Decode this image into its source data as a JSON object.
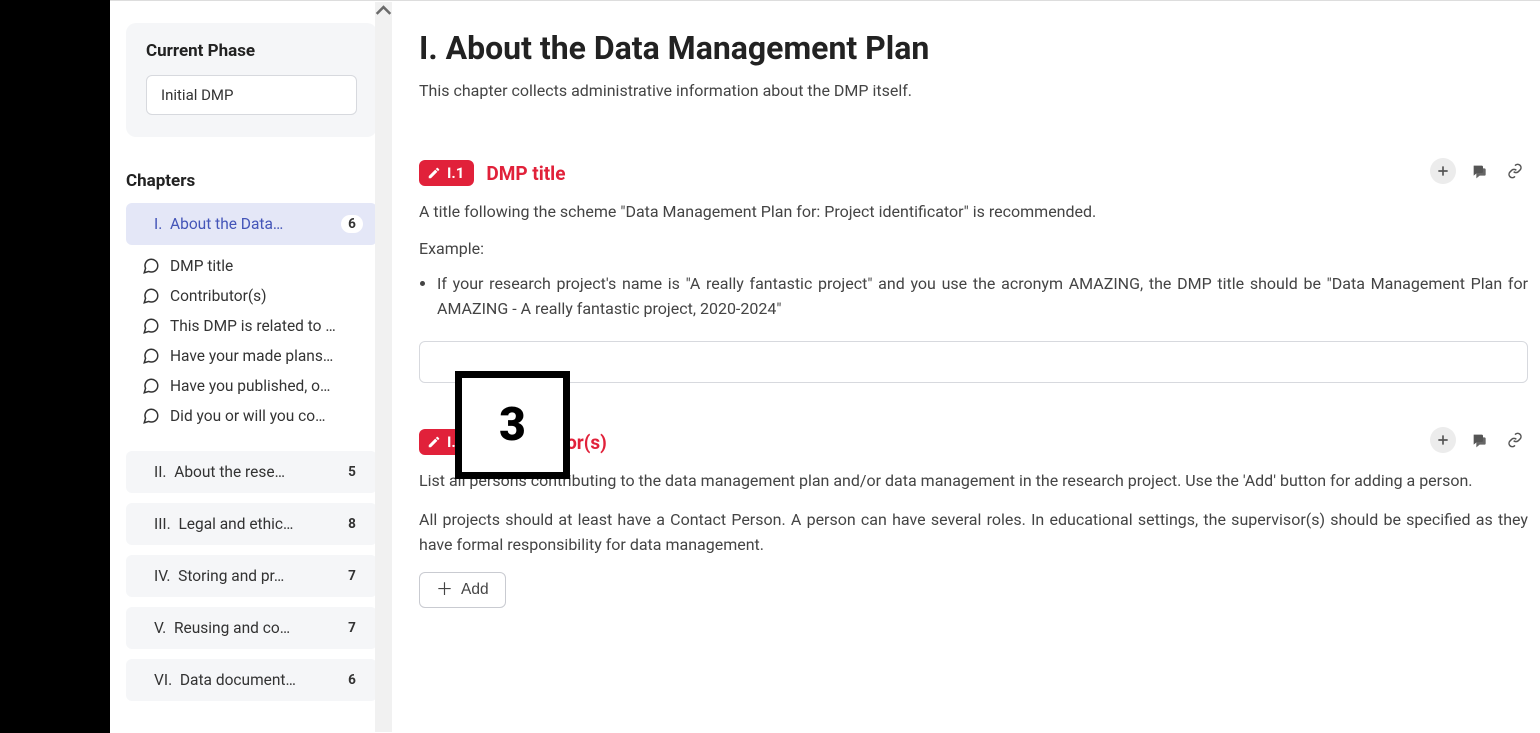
{
  "sidebar": {
    "phase_label": "Current Phase",
    "phase_value": "Initial DMP",
    "chapters_label": "Chapters",
    "chapters": [
      {
        "num": "I.",
        "label": "About the Data…",
        "count": "6",
        "active": true
      },
      {
        "num": "II.",
        "label": "About the rese…",
        "count": "5",
        "active": false
      },
      {
        "num": "III.",
        "label": "Legal and ethic…",
        "count": "8",
        "active": false
      },
      {
        "num": "IV.",
        "label": "Storing and pr…",
        "count": "7",
        "active": false
      },
      {
        "num": "V.",
        "label": "Reusing and co…",
        "count": "7",
        "active": false
      },
      {
        "num": "VI.",
        "label": "Data document…",
        "count": "6",
        "active": false
      }
    ],
    "active_questions": [
      "DMP title",
      "Contributor(s)",
      "This DMP is related to …",
      "Have your made plans…",
      "Have you published, o…",
      "Did you or will you co…"
    ]
  },
  "main": {
    "title": "I. About the Data Management Plan",
    "subtitle": "This chapter collects administrative information about the DMP itself.",
    "sections": {
      "s1": {
        "tag": "I.1",
        "title": "DMP title",
        "desc": "A title following the scheme \"Data Management Plan for: Project identificator\" is recommended.",
        "example_label": "Example:",
        "bullet": "If your research project's name is \"A really fantastic project\" and you use the acronym AMAZING, the DMP title should be \"Data Management Plan for AMAZING - A really fantastic project, 2020-2024\"",
        "input_value": ""
      },
      "s2": {
        "tag": "I.2",
        "title": "Contributor(s)",
        "desc1": "List all persons contributing to the data management plan and/or data management in the research project. Use the 'Add' button for adding a person.",
        "desc2": "All projects should at least have a Contact Person. A person can have several roles. In educational settings, the supervisor(s) should be specified as they have formal responsibility for data management.",
        "add_label": "Add"
      }
    }
  },
  "annotation": {
    "label": "3"
  }
}
